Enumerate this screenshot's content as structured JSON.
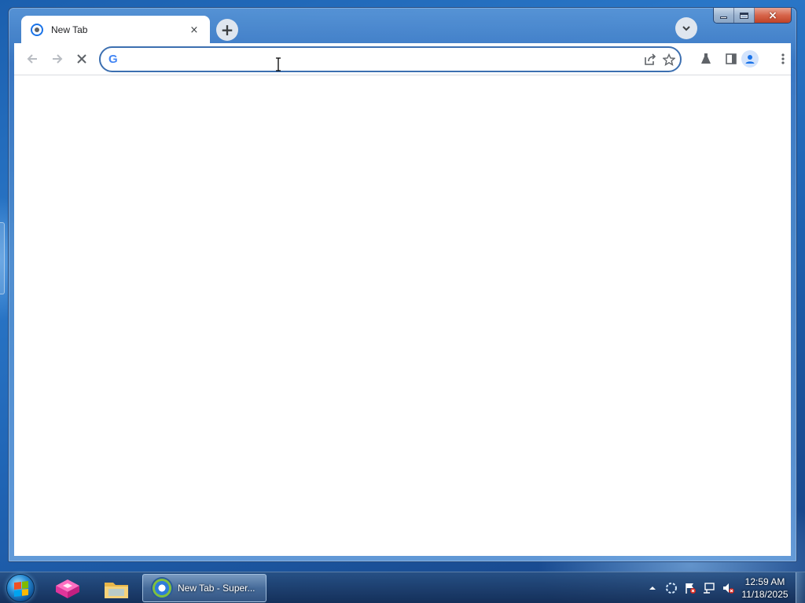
{
  "browser": {
    "tab": {
      "title": "New Tab",
      "close_glyph": "×"
    },
    "new_tab_glyph": "+",
    "omnibox": {
      "value": "",
      "placeholder": ""
    },
    "window_controls": {
      "close_glyph": "×"
    }
  },
  "icons": {
    "back": "arrow-left-icon",
    "forward": "arrow-right-icon",
    "stop": "stop-loading-icon",
    "share": "share-icon",
    "bookmark": "star-icon",
    "labs": "flask-icon",
    "side_panel": "side-panel-icon",
    "profile": "profile-icon",
    "menu": "kebab-menu-icon",
    "tab_search": "chevron-down-icon"
  },
  "taskbar": {
    "active_item_label": "New Tab - Super...",
    "clock": {
      "time": "12:59 AM",
      "date": "11/18/2025"
    }
  },
  "colors": {
    "omnibox_border": "#3c6fb0",
    "google_blue": "#4285f4",
    "google_red": "#ea4335",
    "google_yellow": "#fbbc05",
    "google_green": "#34a853"
  }
}
